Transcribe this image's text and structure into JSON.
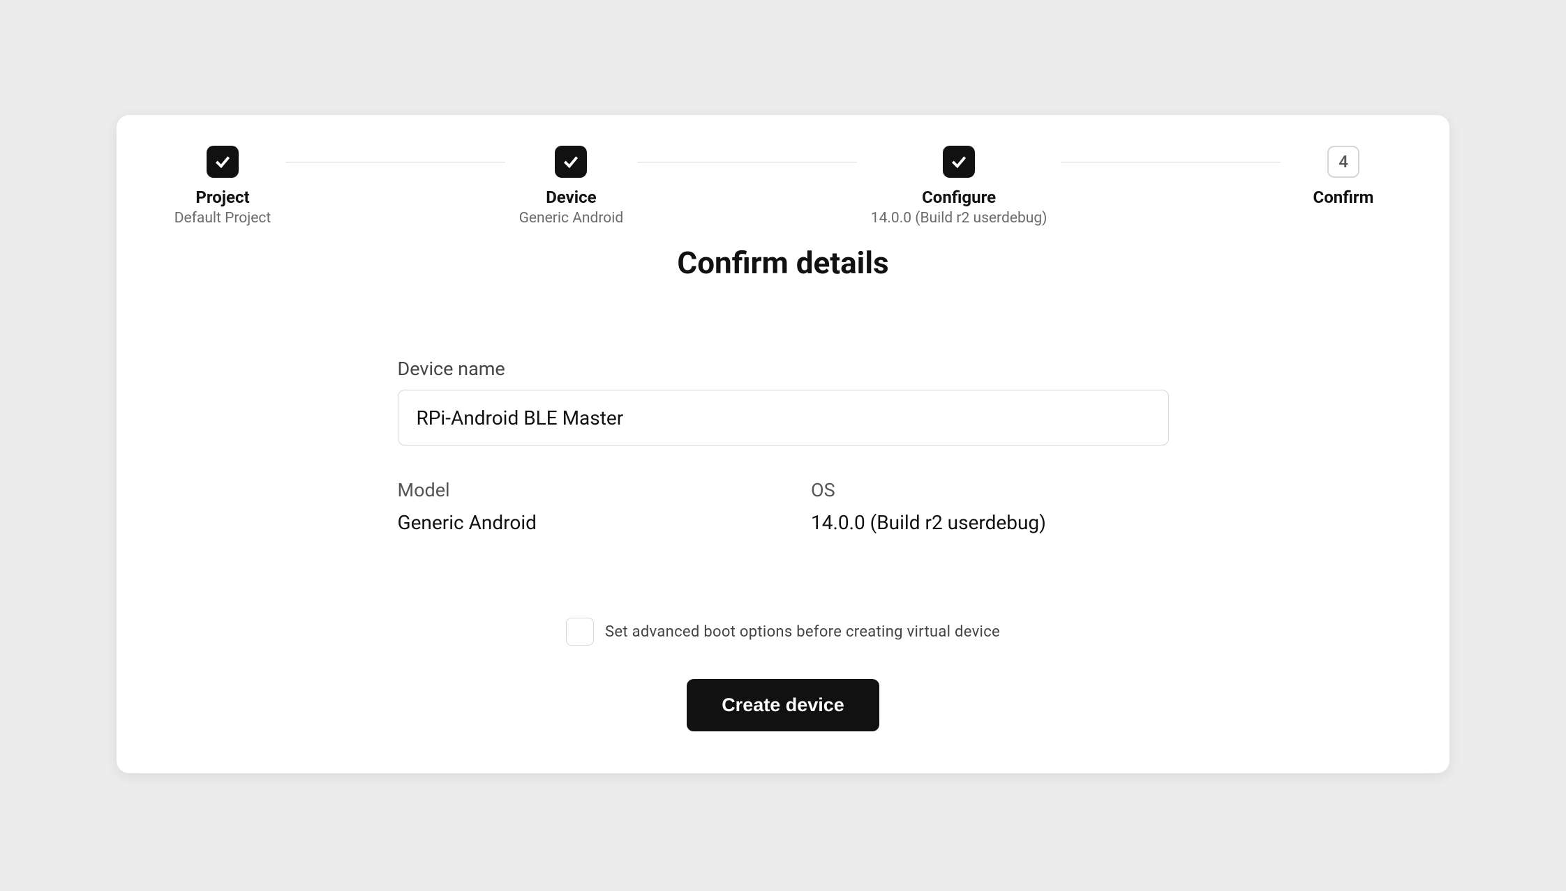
{
  "stepper": {
    "steps": [
      {
        "title": "Project",
        "sub": "Default Project",
        "state": "done"
      },
      {
        "title": "Device",
        "sub": "Generic Android",
        "state": "done"
      },
      {
        "title": "Configure",
        "sub": "14.0.0 (Build r2 userdebug)",
        "state": "done"
      },
      {
        "title": "Confirm",
        "sub": "",
        "state": "current",
        "number": "4"
      }
    ]
  },
  "page": {
    "title": "Confirm details"
  },
  "form": {
    "device_name_label": "Device name",
    "device_name_value": "RPi-Android BLE Master",
    "model_label": "Model",
    "model_value": "Generic Android",
    "os_label": "OS",
    "os_value": "14.0.0 (Build r2 userdebug)",
    "advanced_checkbox_label": "Set advanced boot options before creating virtual device",
    "create_button_label": "Create device"
  }
}
